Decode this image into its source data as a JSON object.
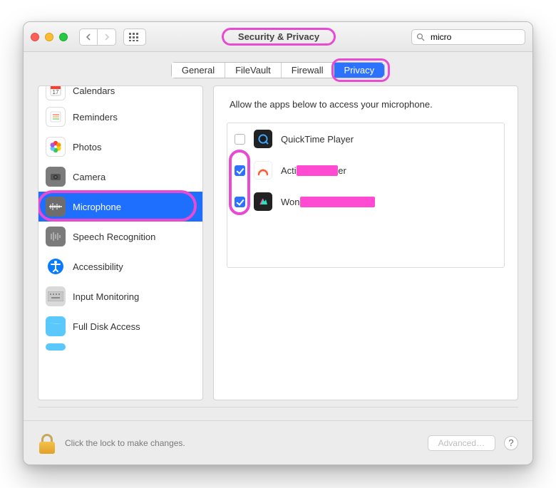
{
  "window": {
    "title": "Security & Privacy"
  },
  "search": {
    "placeholder": "Search",
    "value": "micro"
  },
  "tabs": {
    "items": [
      "General",
      "FileVault",
      "Firewall",
      "Privacy"
    ],
    "active_index": 3
  },
  "sidebar": {
    "items": [
      {
        "id": "calendars",
        "label": "Calendars",
        "icon": "calendar-icon"
      },
      {
        "id": "reminders",
        "label": "Reminders",
        "icon": "reminders-icon"
      },
      {
        "id": "photos",
        "label": "Photos",
        "icon": "photos-icon"
      },
      {
        "id": "camera",
        "label": "Camera",
        "icon": "camera-icon"
      },
      {
        "id": "microphone",
        "label": "Microphone",
        "icon": "microphone-icon",
        "selected": true
      },
      {
        "id": "speech",
        "label": "Speech Recognition",
        "icon": "speech-icon"
      },
      {
        "id": "accessibility",
        "label": "Accessibility",
        "icon": "accessibility-icon"
      },
      {
        "id": "input",
        "label": "Input Monitoring",
        "icon": "keyboard-icon"
      },
      {
        "id": "fulldisk",
        "label": "Full Disk Access",
        "icon": "folder-icon"
      }
    ]
  },
  "panel": {
    "caption": "Allow the apps below to access your microphone.",
    "apps": [
      {
        "name": "QuickTime Player",
        "checked": false,
        "icon": "quicktime-icon"
      },
      {
        "name": "ActivePresenter",
        "checked": true,
        "icon": "activepresenter-icon",
        "redacted": true
      },
      {
        "name": "Wondershare Filmora9",
        "checked": true,
        "icon": "filmora-icon",
        "redacted": true
      }
    ]
  },
  "footer": {
    "lock_message": "Click the lock to make changes.",
    "advanced_label": "Advanced…"
  },
  "annotations": {
    "highlight_color": "#e84bd1",
    "highlighted": [
      "window-title",
      "tab-privacy",
      "sidebar-microphone",
      "app-checkboxes"
    ]
  }
}
